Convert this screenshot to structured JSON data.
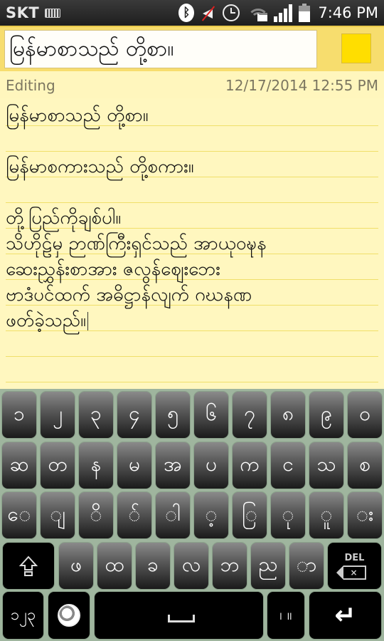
{
  "status_bar": {
    "carrier": "SKT",
    "time": "7:46 PM",
    "icons": [
      "keyboard-icon",
      "bluetooth-icon",
      "mute-icon",
      "alarm-icon",
      "wifi-locked-icon",
      "signal-icon",
      "battery-icon"
    ]
  },
  "note": {
    "title": "မြန်မာစာသည် တို့စာ။",
    "color": "#ffde00",
    "mode": "Editing",
    "timestamp": "12/17/2014 12:55 PM",
    "lines": [
      "မြန်မာစာသည် တို့စာ။",
      "",
      "မြန်မာစကားသည် တို့စကား။",
      "",
      "တို့ပြည်ကိုချစ်ပါ။",
      "သိဟိုဠ်မှ ဉာဏ်ကြီးရှင်သည် အာယုဝဍ္ဎနဆေးညွှန်းစာအား ဇလွန်ဈေးဘေး",
      "ဗာဒံပင်ထက် အဓိဋ္ဌာန်လျက် ဂဃနဏ",
      "ဖတ်ခဲ့သည်။"
    ],
    "display_lines": [
      "မြန်မာစာသည် တို့စာ။",
      "မြန်မာစကားသည် တို့စကား။",
      "တို့ပြည်ကိုချစ်ပါ။",
      "သိဟိုဠ်မှ ဉာဏ်ကြီးရှင်သည် အာယုဝဍ္ဎန",
      "ဆေးညွှန်းစာအား ဇလွန်ဈေးဘေး",
      "ဗာဒံပင်ထက် အဓိဋ္ဌာန်လျက် ဂဃနဏ",
      "ဖတ်ခဲ့သည်။"
    ]
  },
  "keyboard": {
    "row1": [
      "၁",
      "၂",
      "၃",
      "၄",
      "၅",
      "၆",
      "၇",
      "၈",
      "၉",
      "၀"
    ],
    "row2": [
      "ဆ",
      "တ",
      "န",
      "မ",
      "အ",
      "ပ",
      "က",
      "င",
      "သ",
      "စ"
    ],
    "row3": [
      "ေ",
      "ျ",
      "ိ",
      "်",
      "ါ",
      "့",
      "ြ",
      "ု",
      "ူ",
      "း"
    ],
    "row4": [
      "ဖ",
      "ထ",
      "ခ",
      "လ",
      "ဘ",
      "ည",
      "ာ"
    ],
    "shift_label": "shift",
    "del_label": "DEL",
    "del_x": "×",
    "symbols_label": "၁၂၃",
    "globe_label": "language",
    "punct_label": "၊ ။",
    "enter_label": "↵"
  }
}
